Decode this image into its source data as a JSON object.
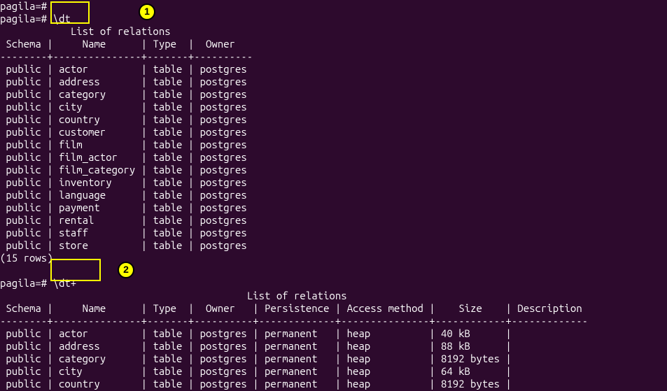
{
  "prompt": "pagila=#",
  "commands": {
    "cmd1": "\\dt",
    "cmd2": "\\dt+"
  },
  "annotations": {
    "num1": "1",
    "num2": "2"
  },
  "table1": {
    "title": "List of relations",
    "headers": {
      "schema": "Schema",
      "name": "Name",
      "type": "Type",
      "owner": "Owner"
    },
    "separator": "--------+---------------+-------+----------",
    "rows": [
      {
        "schema": "public",
        "name": "actor",
        "type": "table",
        "owner": "postgres"
      },
      {
        "schema": "public",
        "name": "address",
        "type": "table",
        "owner": "postgres"
      },
      {
        "schema": "public",
        "name": "category",
        "type": "table",
        "owner": "postgres"
      },
      {
        "schema": "public",
        "name": "city",
        "type": "table",
        "owner": "postgres"
      },
      {
        "schema": "public",
        "name": "country",
        "type": "table",
        "owner": "postgres"
      },
      {
        "schema": "public",
        "name": "customer",
        "type": "table",
        "owner": "postgres"
      },
      {
        "schema": "public",
        "name": "film",
        "type": "table",
        "owner": "postgres"
      },
      {
        "schema": "public",
        "name": "film_actor",
        "type": "table",
        "owner": "postgres"
      },
      {
        "schema": "public",
        "name": "film_category",
        "type": "table",
        "owner": "postgres"
      },
      {
        "schema": "public",
        "name": "inventory",
        "type": "table",
        "owner": "postgres"
      },
      {
        "schema": "public",
        "name": "language",
        "type": "table",
        "owner": "postgres"
      },
      {
        "schema": "public",
        "name": "payment",
        "type": "table",
        "owner": "postgres"
      },
      {
        "schema": "public",
        "name": "rental",
        "type": "table",
        "owner": "postgres"
      },
      {
        "schema": "public",
        "name": "staff",
        "type": "table",
        "owner": "postgres"
      },
      {
        "schema": "public",
        "name": "store",
        "type": "table",
        "owner": "postgres"
      }
    ],
    "footer": "(15 rows)"
  },
  "table2": {
    "title": "List of relations",
    "headers": {
      "schema": "Schema",
      "name": "Name",
      "type": "Type",
      "owner": "Owner",
      "persistence": "Persistence",
      "access_method": "Access method",
      "size": "Size",
      "description": "Description"
    },
    "separator": "--------+---------------+-------+----------+-------------+---------------+------------+-------------",
    "rows": [
      {
        "schema": "public",
        "name": "actor",
        "type": "table",
        "owner": "postgres",
        "persistence": "permanent",
        "access_method": "heap",
        "size": "40 kB",
        "description": ""
      },
      {
        "schema": "public",
        "name": "address",
        "type": "table",
        "owner": "postgres",
        "persistence": "permanent",
        "access_method": "heap",
        "size": "88 kB",
        "description": ""
      },
      {
        "schema": "public",
        "name": "category",
        "type": "table",
        "owner": "postgres",
        "persistence": "permanent",
        "access_method": "heap",
        "size": "8192 bytes",
        "description": ""
      },
      {
        "schema": "public",
        "name": "city",
        "type": "table",
        "owner": "postgres",
        "persistence": "permanent",
        "access_method": "heap",
        "size": "64 kB",
        "description": ""
      },
      {
        "schema": "public",
        "name": "country",
        "type": "table",
        "owner": "postgres",
        "persistence": "permanent",
        "access_method": "heap",
        "size": "8192 bytes",
        "description": ""
      }
    ]
  }
}
